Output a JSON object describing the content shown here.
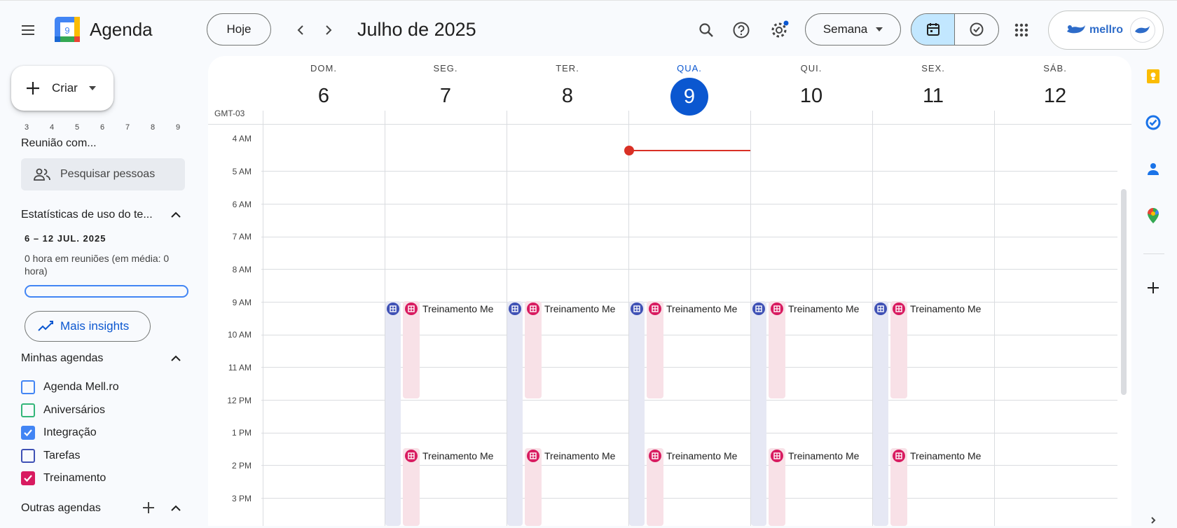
{
  "app": {
    "name": "Agenda"
  },
  "toolbar": {
    "today_label": "Hoje",
    "month_title": "Julho de 2025",
    "view_label": "Semana",
    "account_label": "mellro"
  },
  "sidebar": {
    "create_label": "Criar",
    "mini_days": [
      "3",
      "4",
      "5",
      "6",
      "7",
      "8",
      "9"
    ],
    "meet_title": "Reunião com...",
    "search_people_placeholder": "Pesquisar pessoas",
    "stats_title": "Estatísticas de uso do te...",
    "stats_date": "6 – 12 JUL. 2025",
    "stats_text": "0 hora em reuniões (em média: 0 hora)",
    "insights_label": "Mais insights",
    "my_calendars_title": "Minhas agendas",
    "calendars": [
      {
        "label": "Agenda Mell.ro",
        "checked": false,
        "color": "#4285f4"
      },
      {
        "label": "Aniversários",
        "checked": false,
        "color": "#33b679"
      },
      {
        "label": "Integração",
        "checked": true,
        "color": "#4285f4"
      },
      {
        "label": "Tarefas",
        "checked": false,
        "color": "#3f51b5"
      },
      {
        "label": "Treinamento",
        "checked": true,
        "color": "#d81b60"
      }
    ],
    "other_calendars_title": "Outras agendas"
  },
  "week": {
    "timezone": "GMT-03",
    "days": [
      {
        "name": "DOM.",
        "num": "6"
      },
      {
        "name": "SEG.",
        "num": "7"
      },
      {
        "name": "TER.",
        "num": "8"
      },
      {
        "name": "QUA.",
        "num": "9",
        "today": true
      },
      {
        "name": "QUI.",
        "num": "10"
      },
      {
        "name": "SEX.",
        "num": "11"
      },
      {
        "name": "SÁB.",
        "num": "12"
      }
    ],
    "hours": [
      "4 AM",
      "5 AM",
      "6 AM",
      "7 AM",
      "8 AM",
      "9 AM",
      "10 AM",
      "11 AM",
      "12 PM",
      "1 PM",
      "2 PM",
      "3 PM"
    ],
    "event_title": "Treinamento Me"
  },
  "colors": {
    "accent": "#0b57d0",
    "now": "#d93025",
    "training": "#d81b60",
    "integration": "#3f51b5"
  }
}
